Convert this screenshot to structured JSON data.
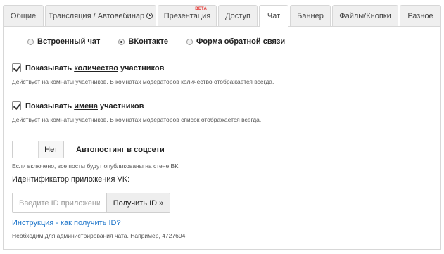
{
  "tabs": [
    {
      "label": "Общие"
    },
    {
      "label": "Трансляция / Автовебинар",
      "icon": "clock-icon"
    },
    {
      "label": "Презентация",
      "badge": "BETA"
    },
    {
      "label": "Доступ"
    },
    {
      "label": "Чат",
      "active": true
    },
    {
      "label": "Баннер"
    },
    {
      "label": "Файлы/Кнопки"
    },
    {
      "label": "Разное"
    }
  ],
  "chat_type": {
    "options": [
      {
        "label": "Встроенный чат",
        "checked": false
      },
      {
        "label": "ВКонтакте",
        "checked": true
      },
      {
        "label": "Форма обратной связи",
        "checked": false
      }
    ]
  },
  "show_count": {
    "label_prefix": "Показывать ",
    "label_emph": "количество",
    "label_suffix": " участников",
    "checked": true,
    "hint": "Действует на комнаты участников. В комнатах модераторов количество отображается всегда."
  },
  "show_names": {
    "label_prefix": "Показывать ",
    "label_emph": "имена",
    "label_suffix": " участников",
    "checked": true,
    "hint": "Действует на комнаты участников. В комнатах модераторов список отображается всегда."
  },
  "autopost": {
    "toggle_value": "Нет",
    "label": "Автопостинг в соцсети",
    "hint": "Если включено, все посты будут опубликованы на стене ВК."
  },
  "vk_app": {
    "label": "Идентификатор приложения VK:",
    "placeholder": "Введите ID приложения",
    "button": "Получить ID »",
    "link": "Инструкция - как получить ID?",
    "hint": "Необходим для администрирования чата. Например, 4727694."
  },
  "colors": {
    "accent_link": "#1a73c9",
    "beta_badge": "#e53935",
    "tab_bg": "#efefef"
  }
}
